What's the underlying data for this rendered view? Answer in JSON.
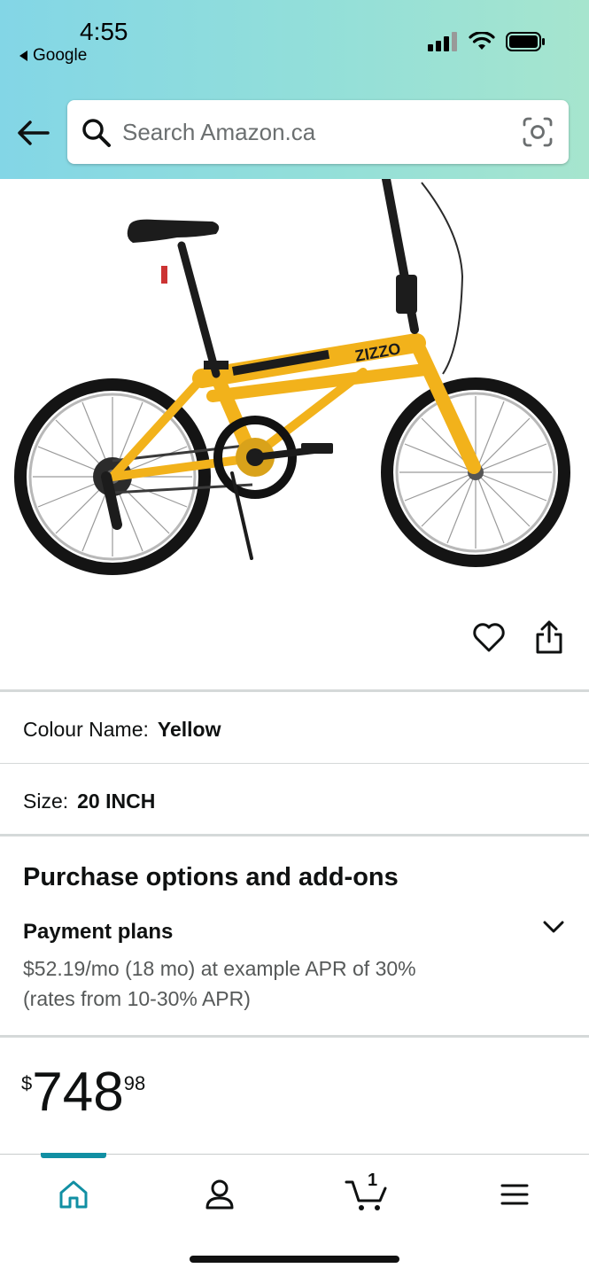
{
  "status_bar": {
    "time": "4:55",
    "back_app": "Google"
  },
  "search": {
    "placeholder": "Search Amazon.ca"
  },
  "product": {
    "image_alt": "Yellow folding bike",
    "brand_on_frame": "ZIZZO"
  },
  "variations": [
    {
      "label": "Colour Name:",
      "value": "Yellow"
    },
    {
      "label": "Size:",
      "value": "20 INCH"
    }
  ],
  "purchase_options": {
    "title": "Purchase options and add-ons",
    "payment_plans_title": "Payment plans",
    "payment_plans_desc": "$52.19/mo (18 mo) at example APR of 30% (rates from 10-30% APR)"
  },
  "price": {
    "symbol": "$",
    "whole": "748",
    "fraction": "98"
  },
  "bottom_nav": {
    "items": [
      {
        "name": "home-icon",
        "active": true
      },
      {
        "name": "account-icon",
        "active": false
      },
      {
        "name": "cart-icon",
        "active": false
      },
      {
        "name": "menu-icon",
        "active": false
      }
    ],
    "cart_count": "1"
  },
  "colors": {
    "header_gradient_start": "#83d6e6",
    "header_gradient_end": "#a6e5ce",
    "active_nav": "#118fa3",
    "frame_yellow": "#f2b21b",
    "text_secondary": "#565959"
  }
}
